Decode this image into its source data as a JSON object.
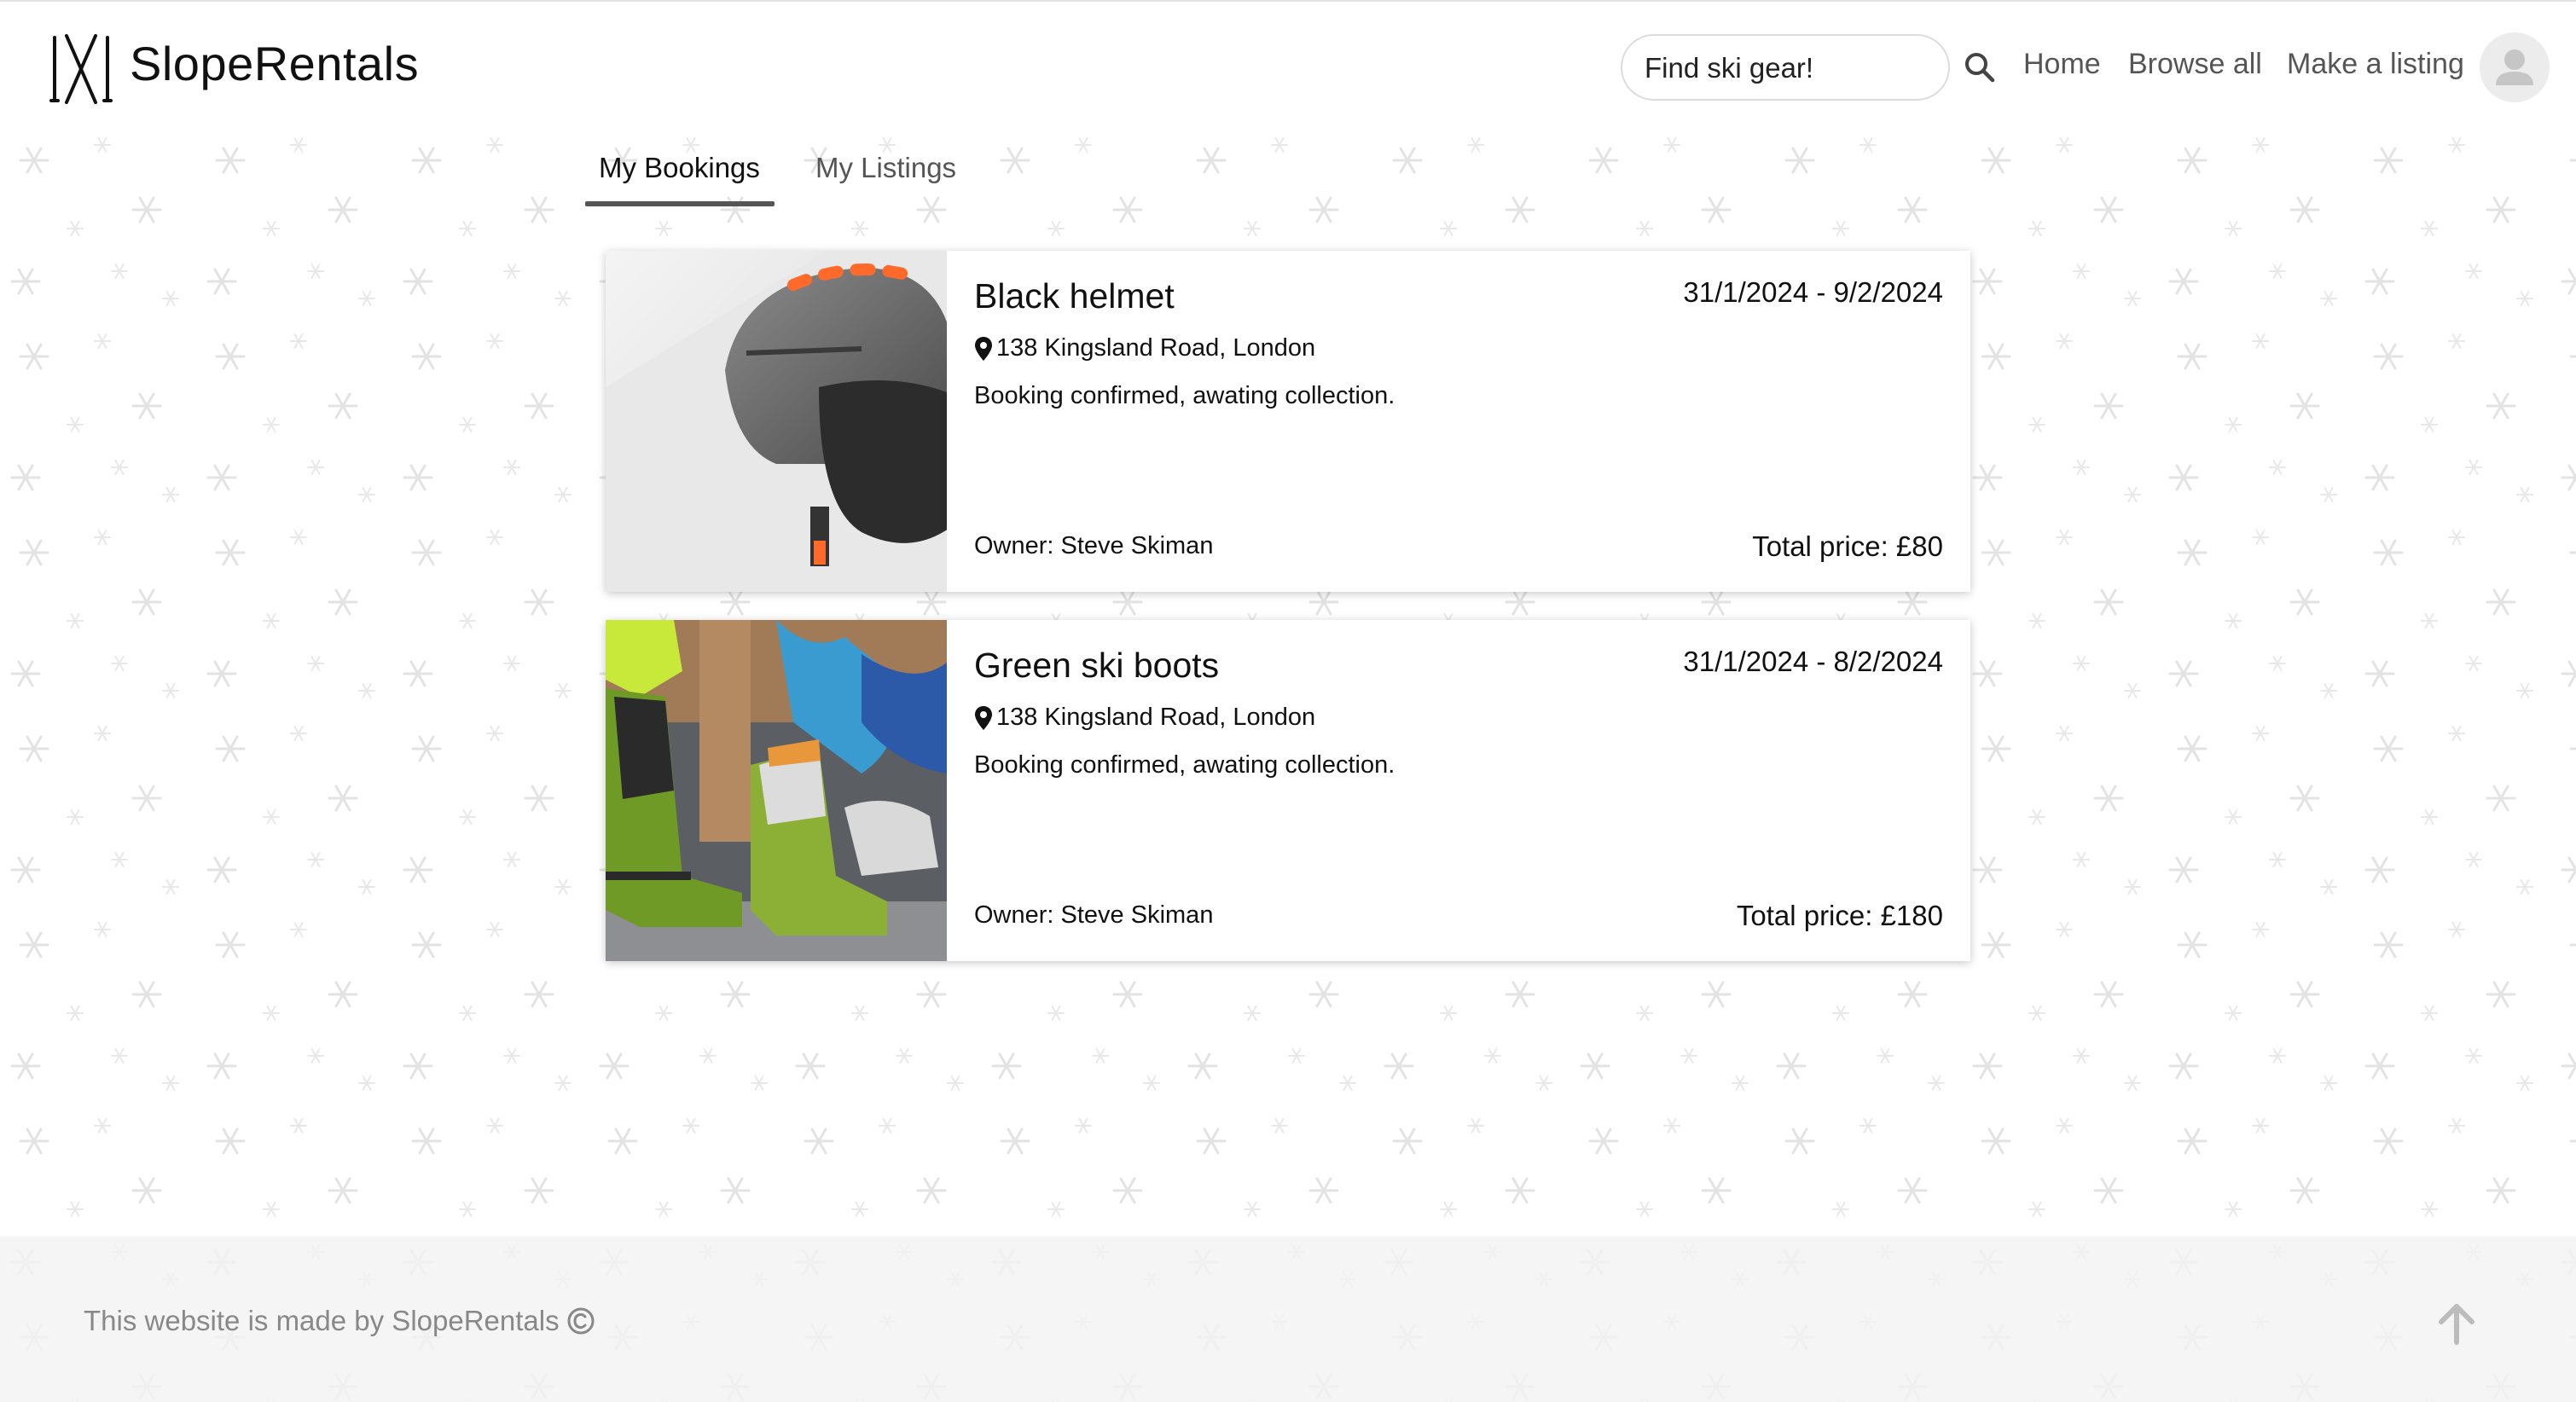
{
  "header": {
    "brand": "SlopeRentals",
    "search_placeholder": "Find ski gear!",
    "nav": {
      "home": "Home",
      "browse": "Browse all",
      "make_listing": "Make a listing"
    }
  },
  "tabs": [
    {
      "label": "My Bookings",
      "active": true
    },
    {
      "label": "My Listings",
      "active": false
    }
  ],
  "bookings": [
    {
      "title": "Black helmet",
      "dates": "31/1/2024 - 9/2/2024",
      "location": "138 Kingsland Road, London",
      "status": "Booking confirmed, awating collection.",
      "owner": "Owner: Steve Skiman",
      "price": "Total price: £80"
    },
    {
      "title": "Green ski boots",
      "dates": "31/1/2024 - 8/2/2024",
      "location": "138 Kingsland Road, London",
      "status": "Booking confirmed, awating collection.",
      "owner": "Owner: Steve Skiman",
      "price": "Total price: £180"
    }
  ],
  "footer": {
    "text": "This website is made by SlopeRentals"
  },
  "colors": {
    "accent": "#555555",
    "helmet_vents": "#ff6a2b",
    "boots": "#8cb035"
  }
}
